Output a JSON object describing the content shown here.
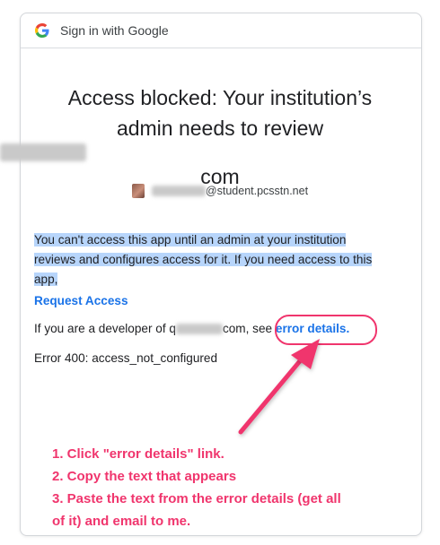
{
  "header": {
    "title": "Sign in with Google",
    "logo_icon": "google-g-icon"
  },
  "heading": {
    "line1": "Access blocked: Your institution’s",
    "line2": "admin needs to review",
    "domain_suffix": "com"
  },
  "account": {
    "email_suffix": "@student.pcsstn.net"
  },
  "message": {
    "text": "You can't access this app until an admin at your institution reviews and configures access for it. If you need access to this app,"
  },
  "request_access_label": "Request Access",
  "developer": {
    "prefix": "If you are a developer of q",
    "suffix": "com, see ",
    "link_label": "error details",
    "period": "."
  },
  "error_code": "Error 400: access_not_configured",
  "instructions": [
    "1. Click \"error details\" link.",
    "2. Copy the text that appears",
    "3. Paste the text from the error details (get all",
    "of it) and email to me."
  ],
  "colors": {
    "annotation": "#f0356d",
    "link": "#1a73e8",
    "highlight": "#b7d5fb"
  }
}
